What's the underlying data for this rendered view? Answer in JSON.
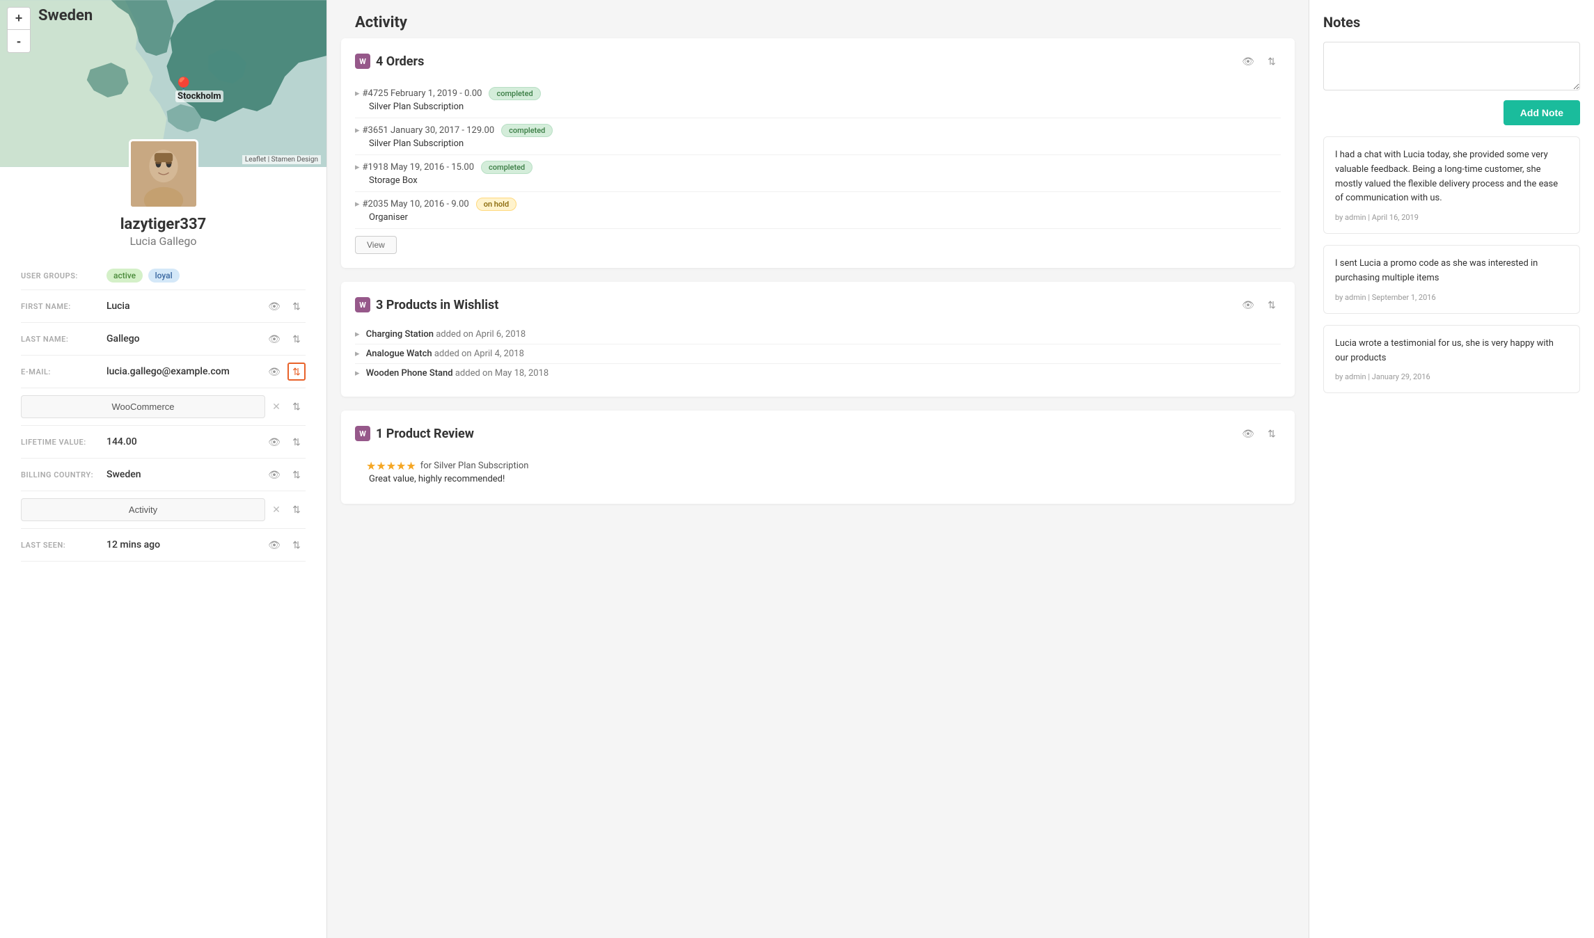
{
  "map": {
    "zoom_in": "+",
    "zoom_out": "-",
    "city": "Stockholm",
    "country": "Sweden",
    "attribution": "Leaflet | Stamen Design"
  },
  "user": {
    "username": "lazytiger337",
    "fullname": "Lucia Gallego",
    "groups": [
      "active",
      "loyal"
    ],
    "fields": {
      "first_name_label": "FIRST NAME:",
      "first_name": "Lucia",
      "last_name_label": "LAST NAME:",
      "last_name": "Gallego",
      "email_label": "E-MAIL:",
      "email": "lucia.gallego@example.com",
      "woocommerce_label": "WooCommerce",
      "lifetime_value_label": "LIFETIME VALUE:",
      "lifetime_value": "144.00",
      "billing_country_label": "BILLING COUNTRY:",
      "billing_country": "Sweden",
      "activity_label": "Activity",
      "last_seen_label": "LAST SEEN:",
      "last_seen": "12 mins ago"
    }
  },
  "activity": {
    "title": "Activity",
    "orders": {
      "section_title": "4 Orders",
      "items": [
        {
          "id": "#4725",
          "date": "February 1, 2019",
          "amount": "0.00",
          "status": "completed",
          "product": "Silver Plan Subscription"
        },
        {
          "id": "#3651",
          "date": "January 30, 2017",
          "amount": "129.00",
          "status": "completed",
          "product": "Silver Plan Subscription"
        },
        {
          "id": "#1918",
          "date": "May 19, 2016",
          "amount": "15.00",
          "status": "completed",
          "product": "Storage Box"
        },
        {
          "id": "#2035",
          "date": "May 10, 2016",
          "amount": "9.00",
          "status": "on hold",
          "product": "Organiser"
        }
      ],
      "view_btn": "View"
    },
    "wishlist": {
      "section_title": "3 Products in Wishlist",
      "items": [
        {
          "product": "Charging Station",
          "date": "April 6, 2018"
        },
        {
          "product": "Analogue Watch",
          "date": "April 4, 2018"
        },
        {
          "product": "Wooden Phone Stand",
          "date": "May 18, 2018"
        }
      ]
    },
    "reviews": {
      "section_title": "1 Product Review",
      "items": [
        {
          "stars": "★★★★★",
          "product": "for Silver Plan Subscription",
          "text": "Great value, highly recommended!"
        }
      ]
    }
  },
  "notes": {
    "title": "Notes",
    "input_placeholder": "",
    "add_button": "Add Note",
    "items": [
      {
        "text": "I had a chat with Lucia today, she provided some very valuable feedback. Being a long-time customer, she mostly valued the flexible delivery process and the ease of communication with us.",
        "meta": "by admin | April 16, 2019"
      },
      {
        "text": "I sent Lucia a promo code as she was interested in purchasing multiple items",
        "meta": "by admin | September 1, 2016"
      },
      {
        "text": "Lucia wrote a testimonial for us, she is very happy with our products",
        "meta": "by admin | January 29, 2016"
      }
    ]
  }
}
